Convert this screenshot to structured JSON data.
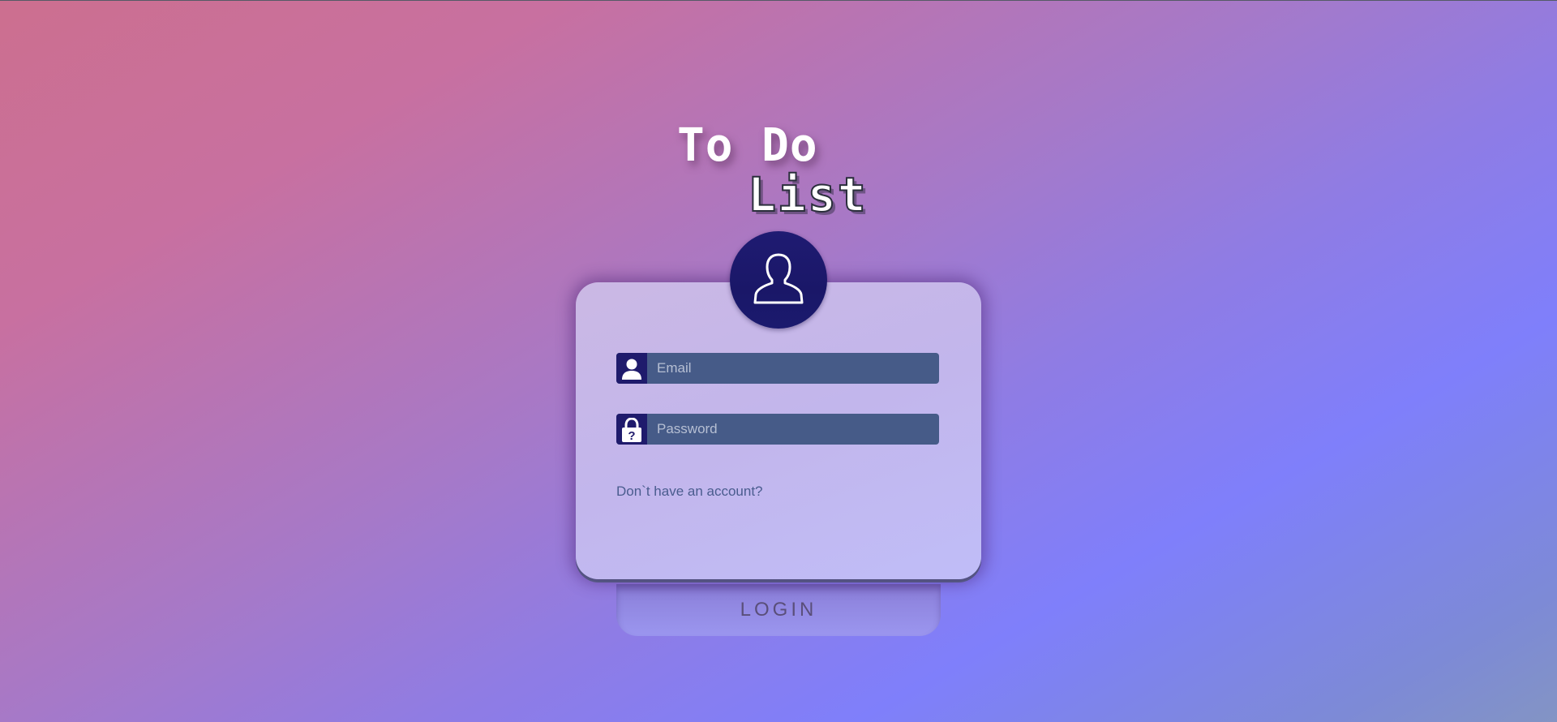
{
  "app": {
    "title_line1": "To Do",
    "title_line2": "List"
  },
  "login_form": {
    "avatar_icon": "user-silhouette-icon",
    "email": {
      "icon": "user-icon",
      "placeholder": "Email",
      "value": ""
    },
    "password": {
      "icon": "lock-question-icon",
      "placeholder": "Password",
      "value": ""
    },
    "signup_link": "Don`t have an account?",
    "submit_label": "LOGIN"
  },
  "colors": {
    "gradient_start": "#cc6f8f",
    "gradient_end": "#7f7ffb",
    "card_bg": "#c2b6ec",
    "avatar_bg": "#1f1b72",
    "input_bg": "#465b88",
    "icon_bg": "#1f1b6c",
    "link_text": "#4a5c8e"
  }
}
